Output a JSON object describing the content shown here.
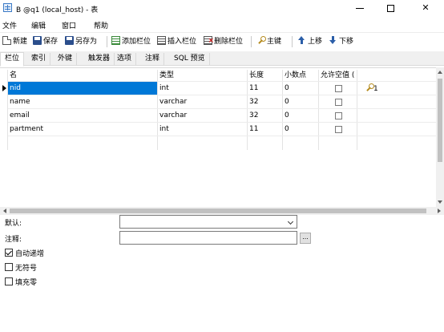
{
  "window": {
    "title": "B @q1 (local_host) - 表",
    "minimize": "—",
    "close": "✕"
  },
  "menu": [
    "文件",
    "编辑",
    "窗口",
    "帮助"
  ],
  "toolbar": {
    "new": "新建",
    "save": "保存",
    "save_as": "另存为",
    "add_field": "添加栏位",
    "insert_field": "插入栏位",
    "delete_field": "删除栏位",
    "primary_key": "主键",
    "move_up": "上移",
    "move_down": "下移"
  },
  "tabs": [
    "栏位",
    "索引",
    "外键",
    "触发器",
    "选项",
    "注释",
    "SQL 预览"
  ],
  "grid": {
    "headers": [
      "名",
      "类型",
      "长度",
      "小数点",
      "允许空值 ("
    ],
    "rows": [
      {
        "name": "nid",
        "type": "int",
        "length": "11",
        "decimals": "0",
        "nullable": false,
        "key": "1",
        "selected": true
      },
      {
        "name": "name",
        "type": "varchar",
        "length": "32",
        "decimals": "0",
        "nullable": false,
        "key": ""
      },
      {
        "name": "email",
        "type": "varchar",
        "length": "32",
        "decimals": "0",
        "nullable": false,
        "key": ""
      },
      {
        "name": "partment",
        "type": "int",
        "length": "11",
        "decimals": "0",
        "nullable": false,
        "key": ""
      }
    ]
  },
  "props": {
    "default_label": "默认:",
    "comment_label": "注释:",
    "ellipsis": "...",
    "auto_increment": "自动递增",
    "auto_increment_checked": true,
    "unsigned": "无符号",
    "unsigned_checked": false,
    "zerofill": "填充零",
    "zerofill_checked": false
  }
}
